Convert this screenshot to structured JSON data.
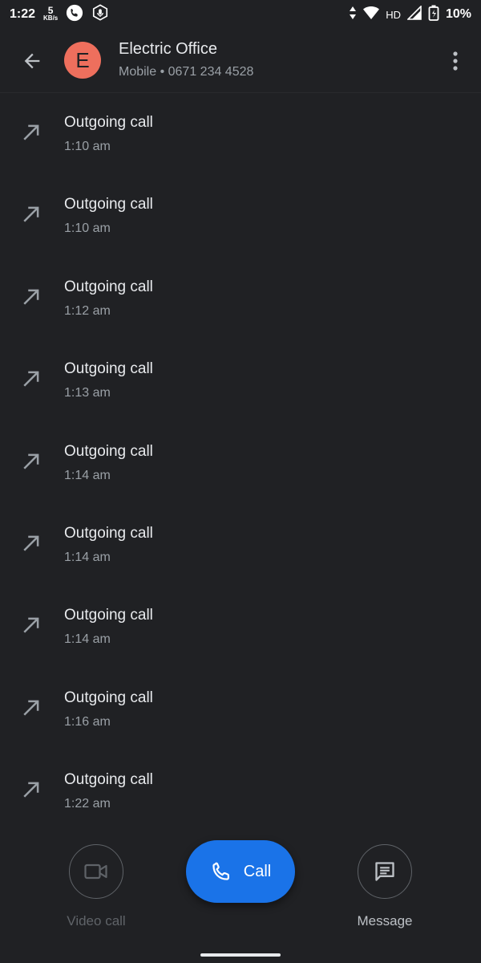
{
  "status_bar": {
    "time": "1:22",
    "net_speed_value": "5",
    "net_speed_unit": "KB/s",
    "network_type": "HD",
    "battery": "10%"
  },
  "header": {
    "contact_initial": "E",
    "contact_name": "Electric Office",
    "contact_detail": "Mobile • 0671 234 4528"
  },
  "calls": [
    {
      "type": "Outgoing call",
      "time": "1:10 am"
    },
    {
      "type": "Outgoing call",
      "time": "1:10 am"
    },
    {
      "type": "Outgoing call",
      "time": "1:12 am"
    },
    {
      "type": "Outgoing call",
      "time": "1:13 am"
    },
    {
      "type": "Outgoing call",
      "time": "1:14 am"
    },
    {
      "type": "Outgoing call",
      "time": "1:14 am"
    },
    {
      "type": "Outgoing call",
      "time": "1:14 am"
    },
    {
      "type": "Outgoing call",
      "time": "1:16 am"
    },
    {
      "type": "Outgoing call",
      "time": "1:22 am"
    }
  ],
  "actions": {
    "video_label": "Video call",
    "call_label": "Call",
    "message_label": "Message"
  },
  "icons": {
    "back": "arrow-left-icon",
    "menu": "more-vert-icon",
    "outgoing": "call-made-icon",
    "video": "videocam-icon",
    "call": "phone-icon",
    "message": "message-icon"
  },
  "colors": {
    "background": "#202124",
    "accent": "#1a73e8",
    "avatar": "#ee6f5d"
  }
}
